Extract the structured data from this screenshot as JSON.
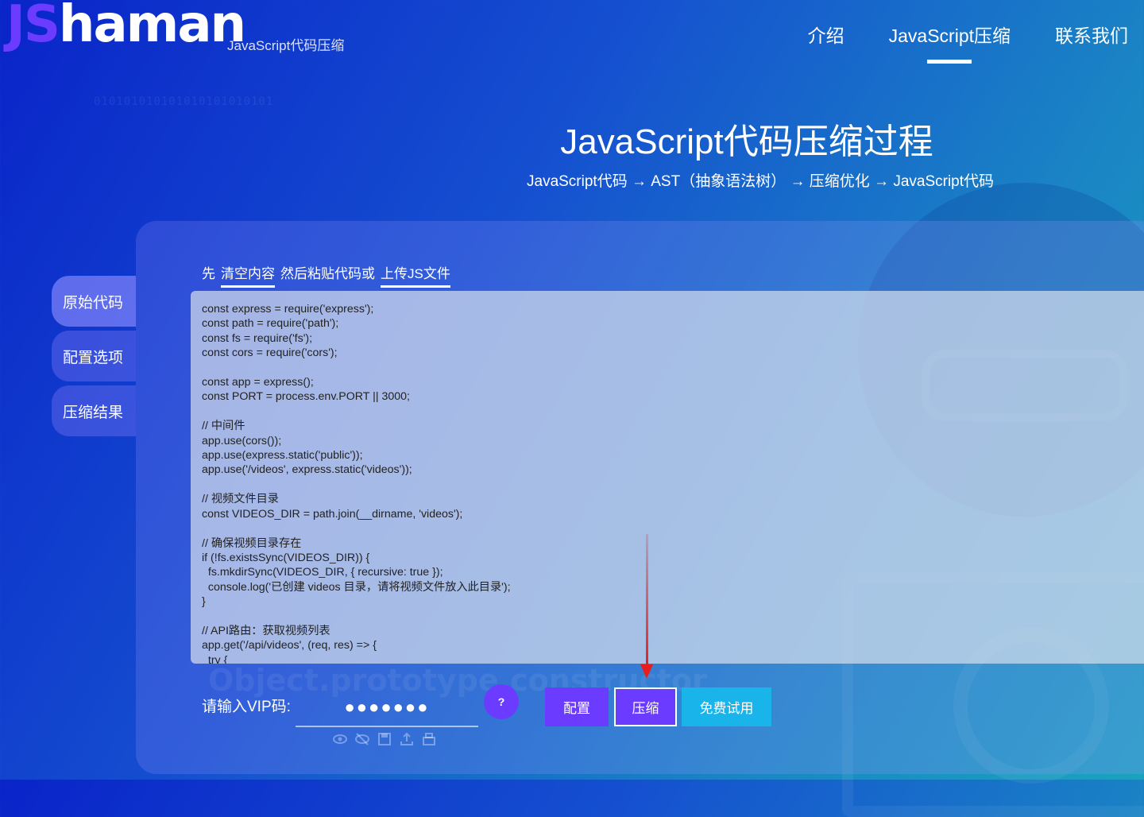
{
  "header": {
    "logo_js": "JS",
    "logo_rest": "haman",
    "logo_subtitle": "JavaScript代码压缩",
    "nav": [
      {
        "label": "介绍"
      },
      {
        "label": "JavaScript压缩",
        "active": true
      },
      {
        "label": "联系我们"
      }
    ]
  },
  "background": {
    "binary_text": "010101010101010101010101",
    "watermark": "Object.prototype.constructor"
  },
  "hero": {
    "title": "JavaScript代码压缩过程",
    "subtitle": "JavaScript代码 → AST（抽象语法树） → 压缩优化 → JavaScript代码"
  },
  "side_tabs": [
    {
      "label": "原始代码",
      "active": true
    },
    {
      "label": "配置选项"
    },
    {
      "label": "压缩结果"
    }
  ],
  "hint": {
    "prefix": "先",
    "clear_link": "清空内容",
    "middle": "然后粘贴代码或",
    "upload_link": "上传JS文件"
  },
  "editor": {
    "code": "const express = require('express');\nconst path = require('path');\nconst fs = require('fs');\nconst cors = require('cors');\n\nconst app = express();\nconst PORT = process.env.PORT || 3000;\n\n// 中间件\napp.use(cors());\napp.use(express.static('public'));\napp.use('/videos', express.static('videos'));\n\n// 视频文件目录\nconst VIDEOS_DIR = path.join(__dirname, 'videos');\n\n// 确保视频目录存在\nif (!fs.existsSync(VIDEOS_DIR)) {\n  fs.mkdirSync(VIDEOS_DIR, { recursive: true });\n  console.log('已创建 videos 目录，请将视频文件放入此目录');\n}\n\n// API路由：获取视频列表\napp.get('/api/videos', (req, res) => {\n  try {"
  },
  "vip": {
    "label": "请输入VIP码:",
    "value": "●●●●●●●",
    "help_label": "?",
    "icons": [
      "eye-icon",
      "eye-off-icon",
      "save-icon",
      "upload-icon",
      "print-icon"
    ]
  },
  "buttons": {
    "config": "配置",
    "compress": "压缩",
    "trial": "免费试用"
  },
  "colors": {
    "accent_purple": "#6b3cff",
    "accent_cyan": "#18b4ea",
    "annotation_red": "#e61e1e"
  }
}
